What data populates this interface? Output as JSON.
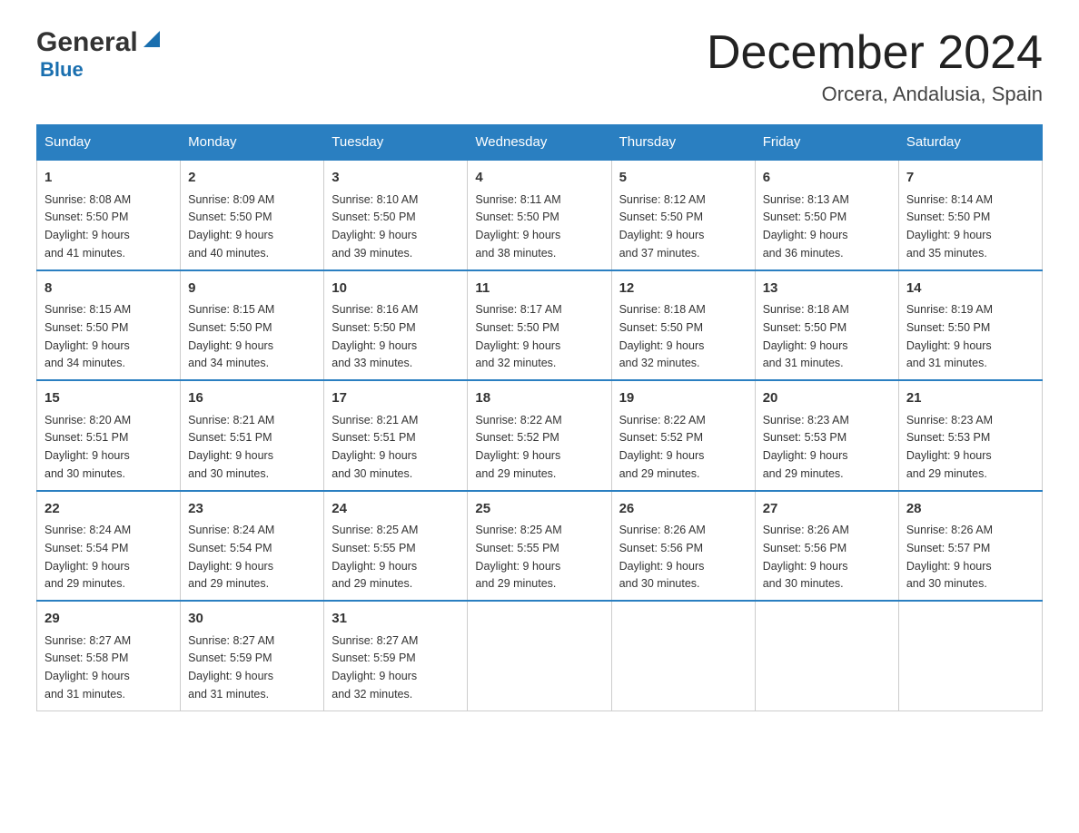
{
  "header": {
    "logo_general": "General",
    "logo_blue": "Blue",
    "main_title": "December 2024",
    "subtitle": "Orcera, Andalusia, Spain"
  },
  "days_of_week": [
    "Sunday",
    "Monday",
    "Tuesday",
    "Wednesday",
    "Thursday",
    "Friday",
    "Saturday"
  ],
  "weeks": [
    [
      {
        "day": "1",
        "sunrise": "8:08 AM",
        "sunset": "5:50 PM",
        "daylight": "9 hours and 41 minutes."
      },
      {
        "day": "2",
        "sunrise": "8:09 AM",
        "sunset": "5:50 PM",
        "daylight": "9 hours and 40 minutes."
      },
      {
        "day": "3",
        "sunrise": "8:10 AM",
        "sunset": "5:50 PM",
        "daylight": "9 hours and 39 minutes."
      },
      {
        "day": "4",
        "sunrise": "8:11 AM",
        "sunset": "5:50 PM",
        "daylight": "9 hours and 38 minutes."
      },
      {
        "day": "5",
        "sunrise": "8:12 AM",
        "sunset": "5:50 PM",
        "daylight": "9 hours and 37 minutes."
      },
      {
        "day": "6",
        "sunrise": "8:13 AM",
        "sunset": "5:50 PM",
        "daylight": "9 hours and 36 minutes."
      },
      {
        "day": "7",
        "sunrise": "8:14 AM",
        "sunset": "5:50 PM",
        "daylight": "9 hours and 35 minutes."
      }
    ],
    [
      {
        "day": "8",
        "sunrise": "8:15 AM",
        "sunset": "5:50 PM",
        "daylight": "9 hours and 34 minutes."
      },
      {
        "day": "9",
        "sunrise": "8:15 AM",
        "sunset": "5:50 PM",
        "daylight": "9 hours and 34 minutes."
      },
      {
        "day": "10",
        "sunrise": "8:16 AM",
        "sunset": "5:50 PM",
        "daylight": "9 hours and 33 minutes."
      },
      {
        "day": "11",
        "sunrise": "8:17 AM",
        "sunset": "5:50 PM",
        "daylight": "9 hours and 32 minutes."
      },
      {
        "day": "12",
        "sunrise": "8:18 AM",
        "sunset": "5:50 PM",
        "daylight": "9 hours and 32 minutes."
      },
      {
        "day": "13",
        "sunrise": "8:18 AM",
        "sunset": "5:50 PM",
        "daylight": "9 hours and 31 minutes."
      },
      {
        "day": "14",
        "sunrise": "8:19 AM",
        "sunset": "5:50 PM",
        "daylight": "9 hours and 31 minutes."
      }
    ],
    [
      {
        "day": "15",
        "sunrise": "8:20 AM",
        "sunset": "5:51 PM",
        "daylight": "9 hours and 30 minutes."
      },
      {
        "day": "16",
        "sunrise": "8:21 AM",
        "sunset": "5:51 PM",
        "daylight": "9 hours and 30 minutes."
      },
      {
        "day": "17",
        "sunrise": "8:21 AM",
        "sunset": "5:51 PM",
        "daylight": "9 hours and 30 minutes."
      },
      {
        "day": "18",
        "sunrise": "8:22 AM",
        "sunset": "5:52 PM",
        "daylight": "9 hours and 29 minutes."
      },
      {
        "day": "19",
        "sunrise": "8:22 AM",
        "sunset": "5:52 PM",
        "daylight": "9 hours and 29 minutes."
      },
      {
        "day": "20",
        "sunrise": "8:23 AM",
        "sunset": "5:53 PM",
        "daylight": "9 hours and 29 minutes."
      },
      {
        "day": "21",
        "sunrise": "8:23 AM",
        "sunset": "5:53 PM",
        "daylight": "9 hours and 29 minutes."
      }
    ],
    [
      {
        "day": "22",
        "sunrise": "8:24 AM",
        "sunset": "5:54 PM",
        "daylight": "9 hours and 29 minutes."
      },
      {
        "day": "23",
        "sunrise": "8:24 AM",
        "sunset": "5:54 PM",
        "daylight": "9 hours and 29 minutes."
      },
      {
        "day": "24",
        "sunrise": "8:25 AM",
        "sunset": "5:55 PM",
        "daylight": "9 hours and 29 minutes."
      },
      {
        "day": "25",
        "sunrise": "8:25 AM",
        "sunset": "5:55 PM",
        "daylight": "9 hours and 29 minutes."
      },
      {
        "day": "26",
        "sunrise": "8:26 AM",
        "sunset": "5:56 PM",
        "daylight": "9 hours and 30 minutes."
      },
      {
        "day": "27",
        "sunrise": "8:26 AM",
        "sunset": "5:56 PM",
        "daylight": "9 hours and 30 minutes."
      },
      {
        "day": "28",
        "sunrise": "8:26 AM",
        "sunset": "5:57 PM",
        "daylight": "9 hours and 30 minutes."
      }
    ],
    [
      {
        "day": "29",
        "sunrise": "8:27 AM",
        "sunset": "5:58 PM",
        "daylight": "9 hours and 31 minutes."
      },
      {
        "day": "30",
        "sunrise": "8:27 AM",
        "sunset": "5:59 PM",
        "daylight": "9 hours and 31 minutes."
      },
      {
        "day": "31",
        "sunrise": "8:27 AM",
        "sunset": "5:59 PM",
        "daylight": "9 hours and 32 minutes."
      },
      null,
      null,
      null,
      null
    ]
  ],
  "labels": {
    "sunrise": "Sunrise:",
    "sunset": "Sunset:",
    "daylight": "Daylight:"
  }
}
